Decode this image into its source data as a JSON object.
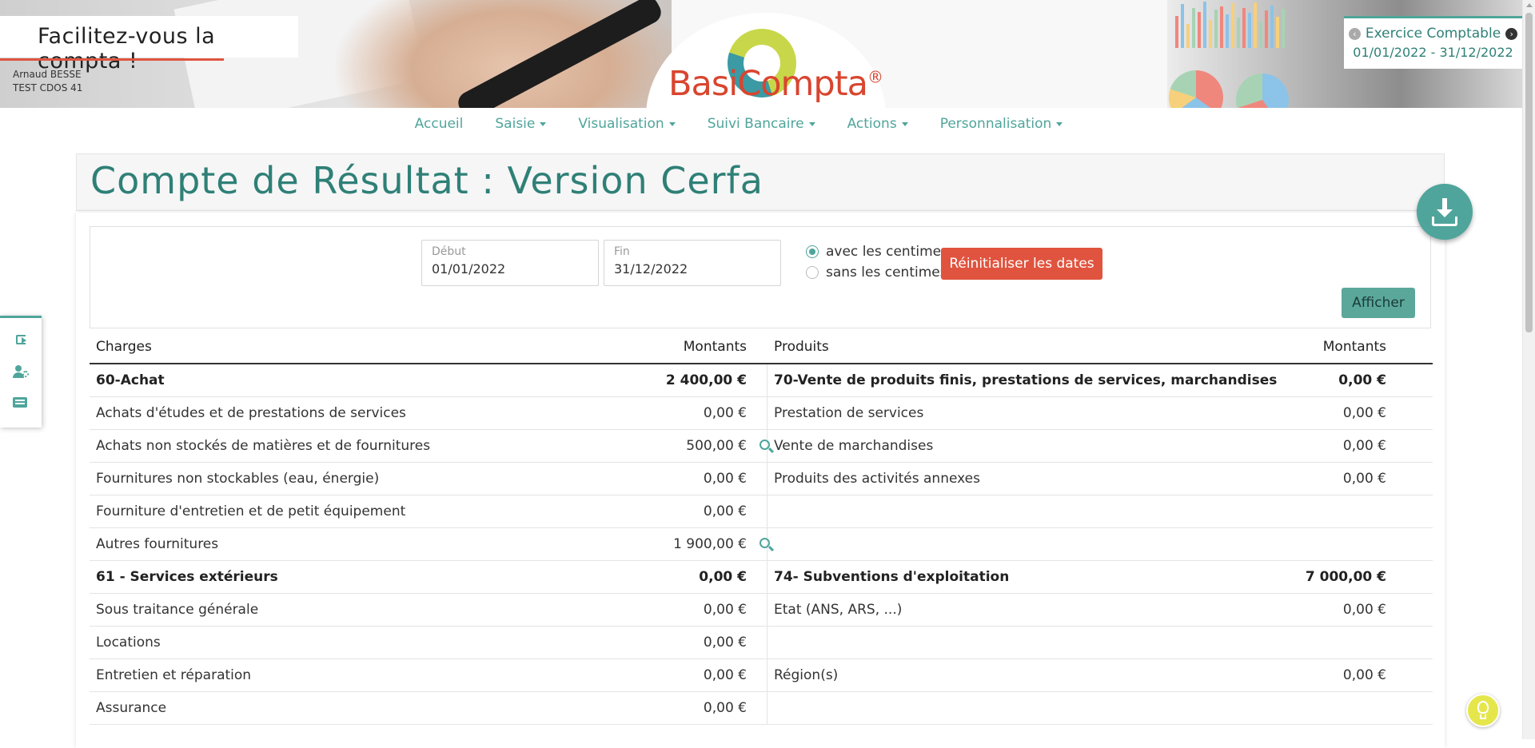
{
  "header": {
    "tagline": "Facilitez-vous la compta !",
    "user_name": "Arnaud BESSE",
    "organization": "TEST CDOS 41",
    "logo_text": "BasiCompta",
    "logo_mark": "®",
    "exercice": {
      "title": "Exercice Comptable",
      "dates": "01/01/2022 - 31/12/2022",
      "prev_icon": "chevron-left-circle-icon",
      "next_icon": "chevron-right-circle-icon"
    }
  },
  "nav": {
    "items": [
      {
        "label": "Accueil",
        "dropdown": false
      },
      {
        "label": "Saisie",
        "dropdown": true
      },
      {
        "label": "Visualisation",
        "dropdown": true
      },
      {
        "label": "Suivi Bancaire",
        "dropdown": true
      },
      {
        "label": "Actions",
        "dropdown": true
      },
      {
        "label": "Personnalisation",
        "dropdown": true
      }
    ]
  },
  "page": {
    "title": "Compte de Résultat : Version Cerfa",
    "download_icon": "download-icon"
  },
  "filters": {
    "debut": {
      "label": "Début",
      "value": "01/01/2022"
    },
    "fin": {
      "label": "Fin",
      "value": "31/12/2022"
    },
    "centimes": {
      "options": [
        "avec les centimes",
        "sans les centimes"
      ],
      "selected": "avec les centimes"
    },
    "reset_label": "Réinitialiser les dates",
    "show_label": "Afficher"
  },
  "table": {
    "headers": {
      "charges": "Charges",
      "charges_amount": "Montants",
      "produits": "Produits",
      "produits_amount": "Montants"
    },
    "rows": [
      {
        "charge": "60-Achat",
        "charge_amount": "2 400,00 €",
        "zoom": false,
        "produit": "70-Vente de produits finis, prestations de services, marchandises",
        "produit_amount": "0,00 €",
        "bold": true
      },
      {
        "charge": "Achats d'études et de prestations de services",
        "charge_amount": "0,00 €",
        "zoom": false,
        "produit": "Prestation de services",
        "produit_amount": "0,00 €",
        "bold": false
      },
      {
        "charge": "Achats non stockés de matières et de fournitures",
        "charge_amount": "500,00 €",
        "zoom": true,
        "produit": "Vente de marchandises",
        "produit_amount": "0,00 €",
        "bold": false
      },
      {
        "charge": "Fournitures non stockables (eau, énergie)",
        "charge_amount": "0,00 €",
        "zoom": false,
        "produit": "Produits des activités annexes",
        "produit_amount": "0,00 €",
        "bold": false
      },
      {
        "charge": "Fourniture d'entretien et de petit équipement",
        "charge_amount": "0,00 €",
        "zoom": false,
        "produit": "",
        "produit_amount": "",
        "bold": false
      },
      {
        "charge": "Autres fournitures",
        "charge_amount": "1 900,00 €",
        "zoom": true,
        "produit": "",
        "produit_amount": "",
        "bold": false
      },
      {
        "charge": "61 - Services extérieurs",
        "charge_amount": "0,00 €",
        "zoom": false,
        "produit": "74- Subventions d'exploitation",
        "produit_amount": "7 000,00 €",
        "bold": true
      },
      {
        "charge": "Sous traitance générale",
        "charge_amount": "0,00 €",
        "zoom": false,
        "produit": "Etat (ANS, ARS, ...)",
        "produit_amount": "0,00 €",
        "bold": false
      },
      {
        "charge": "Locations",
        "charge_amount": "0,00 €",
        "zoom": false,
        "produit": "",
        "produit_amount": "",
        "bold": false
      },
      {
        "charge": "Entretien et réparation",
        "charge_amount": "0,00 €",
        "zoom": false,
        "produit": "Région(s)",
        "produit_amount": "0,00 €",
        "bold": false
      },
      {
        "charge": "Assurance",
        "charge_amount": "0,00 €",
        "zoom": false,
        "produit": "",
        "produit_amount": "",
        "bold": false
      }
    ]
  },
  "sidebar": {
    "icons": [
      "logout-icon",
      "user-settings-icon",
      "list-icon"
    ]
  },
  "help_icon": "lightbulb-icon",
  "colors": {
    "accent": "#4fa59b",
    "title": "#2f8077",
    "danger": "#e0543f",
    "logo_red": "#d9452f",
    "help": "#e5e64b"
  }
}
